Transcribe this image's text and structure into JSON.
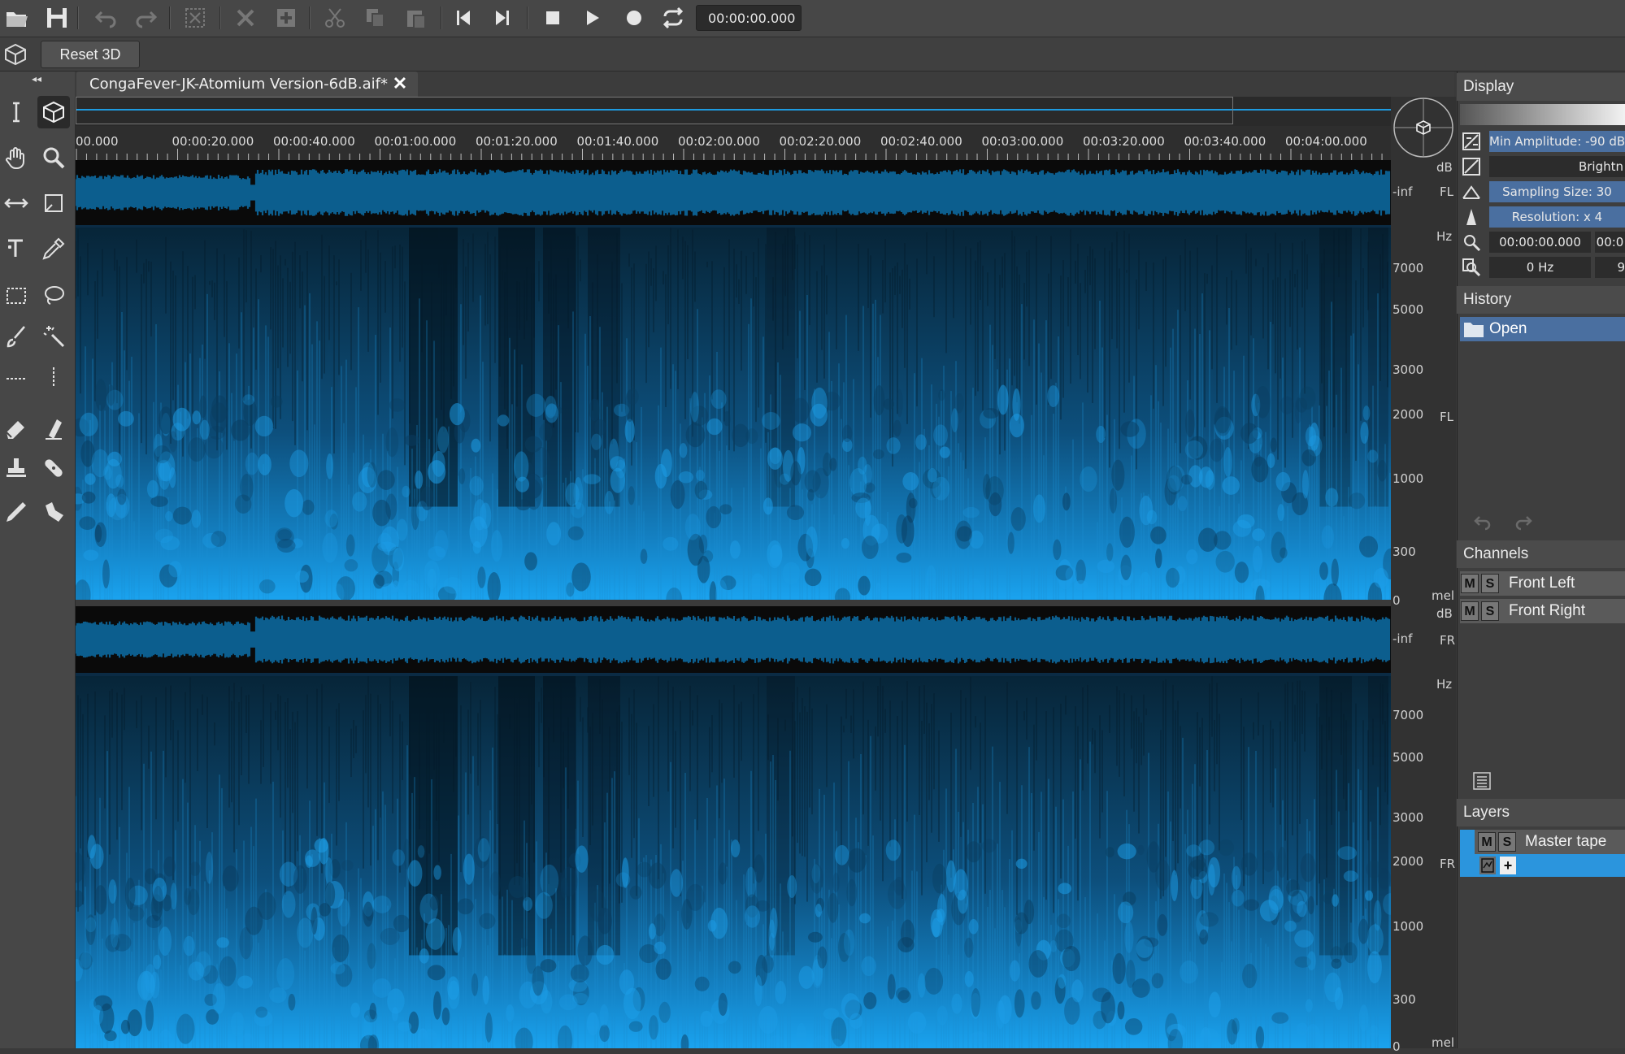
{
  "toolbar": {
    "time": "00:00:00.000",
    "icons": [
      "open-folder-icon",
      "save-icon",
      "undo-icon",
      "redo-icon",
      "select-all-icon",
      "delete-icon",
      "insert-icon",
      "cut-icon",
      "copy-icon",
      "paste-icon",
      "skip-to-start-icon",
      "skip-to-end-icon",
      "stop-icon",
      "play-icon",
      "record-icon",
      "loop-icon"
    ]
  },
  "row2": {
    "reset3d_label": "Reset 3D"
  },
  "tab": {
    "title": "CongaFever-JK-Atomium Version-6dB.aif*",
    "close": "✕"
  },
  "ruler": {
    "ticks": [
      "00.000",
      "00:00:20.000",
      "00:00:40.000",
      "00:01:00.000",
      "00:01:20.000",
      "00:01:40.000",
      "00:02:00.000",
      "00:02:20.000",
      "00:02:40.000",
      "00:03:00.000",
      "00:03:20.000",
      "00:03:40.000",
      "00:04:00.000"
    ]
  },
  "axis": {
    "top": {
      "db": "dB",
      "inf": "-inf",
      "ch": "FL",
      "hz": "Hz",
      "freqs": [
        "7000",
        "5000",
        "3000",
        "2000",
        "1000",
        "300",
        "0"
      ],
      "ch2": "FL",
      "mel": "mel"
    },
    "bottom": {
      "db": "dB",
      "inf": "-inf",
      "ch": "FR",
      "hz": "Hz",
      "freqs": [
        "7000",
        "5000",
        "3000",
        "2000",
        "1000",
        "300",
        "0"
      ],
      "ch2": "FR",
      "mel": "mel"
    }
  },
  "display": {
    "title": "Display",
    "min_amplitude": "Min Amplitude: -90 dB",
    "brightness": "Brightn",
    "sampling_size": "Sampling Size: 30",
    "resolution": "Resolution: x 4",
    "time_start": "00:00:00.000",
    "time_end": "00:0",
    "freq_low": "0  Hz",
    "freq_high": "9"
  },
  "history": {
    "title": "History",
    "items": [
      "Open"
    ]
  },
  "channels": {
    "title": "Channels",
    "items": [
      {
        "m": "M",
        "s": "S",
        "name": "Front Left"
      },
      {
        "m": "M",
        "s": "S",
        "name": "Front Right"
      }
    ]
  },
  "layers": {
    "title": "Layers",
    "items": [
      {
        "m": "M",
        "s": "S",
        "name": "Master tape"
      }
    ],
    "add": "+"
  },
  "colors": {
    "accent": "#1e9be0",
    "spectro_dark": "#062030",
    "spectro_bright": "#1aa3ef"
  }
}
